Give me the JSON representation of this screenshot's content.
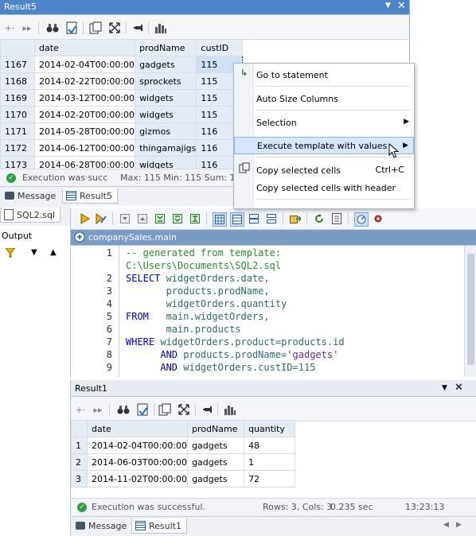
{
  "result5": {
    "title": "Result5",
    "columns": [
      "date",
      "prodName",
      "custID"
    ],
    "rows": [
      {
        "n": "1167",
        "date": "2014-02-04T00:00:00",
        "prod": "gadgets",
        "cust": "115"
      },
      {
        "n": "1168",
        "date": "2014-02-22T00:00:00",
        "prod": "sprockets",
        "cust": "115"
      },
      {
        "n": "1169",
        "date": "2014-03-12T00:00:00",
        "prod": "widgets",
        "cust": "115"
      },
      {
        "n": "1170",
        "date": "2014-02-20T00:00:00",
        "prod": "widgets",
        "cust": "115"
      },
      {
        "n": "1171",
        "date": "2014-05-28T00:00:00",
        "prod": "gizmos",
        "cust": "116"
      },
      {
        "n": "1172",
        "date": "2014-06-12T00:00:00",
        "prod": "thingamajigs",
        "cust": "116"
      },
      {
        "n": "1173",
        "date": "2014-06-28T00:00:00",
        "prod": "widgets",
        "cust": "116"
      }
    ],
    "status": "Execution was succ",
    "stats": "Max: 115  Min: 115   Sum: 11",
    "tabs": [
      "Message",
      "Result5"
    ]
  },
  "context_menu": {
    "items": [
      {
        "label": "Go to statement",
        "shortcut": ""
      },
      {
        "label": "Auto Size Columns",
        "shortcut": ""
      },
      {
        "label": "Selection",
        "shortcut": ""
      },
      {
        "label": "Execute template with values",
        "shortcut": ""
      },
      {
        "label": "Copy selected cells",
        "shortcut": "Ctrl+C"
      },
      {
        "label": "Copy selected cells with header",
        "shortcut": ""
      }
    ]
  },
  "left_panel": {
    "tab": "SQL2.sql",
    "output_label": "Output"
  },
  "editor": {
    "title": "companySales.main",
    "lines": [
      {
        "n": "1",
        "parts": [
          {
            "t": "-- generated from template:",
            "c": "cm"
          }
        ]
      },
      {
        "n": "",
        "parts": [
          {
            "t": "C:\\Users\\Documents\\SQL2.sql",
            "c": "cm"
          }
        ]
      },
      {
        "n": "2",
        "parts": [
          {
            "t": "SELECT ",
            "c": "kw"
          },
          {
            "t": "widgetOrders.date,",
            "c": "tx"
          }
        ]
      },
      {
        "n": "3",
        "parts": [
          {
            "t": "       products.prodName,",
            "c": "tx"
          }
        ]
      },
      {
        "n": "4",
        "parts": [
          {
            "t": "       widgetOrders.quantity",
            "c": "tx"
          }
        ]
      },
      {
        "n": "5",
        "parts": [
          {
            "t": "FROM   ",
            "c": "kw"
          },
          {
            "t": "main.widgetOrders,",
            "c": "tx"
          }
        ]
      },
      {
        "n": "6",
        "parts": [
          {
            "t": "       main.products",
            "c": "tx"
          }
        ]
      },
      {
        "n": "7",
        "parts": [
          {
            "t": "WHERE ",
            "c": "kw"
          },
          {
            "t": "widgetOrders.product=products.id",
            "c": "tx"
          }
        ]
      },
      {
        "n": "8",
        "parts": [
          {
            "t": "      AND ",
            "c": "kw"
          },
          {
            "t": "products.prodName=",
            "c": "tx"
          },
          {
            "t": "'gadgets'",
            "c": "st"
          }
        ]
      },
      {
        "n": "9",
        "parts": [
          {
            "t": "      AND ",
            "c": "kw"
          },
          {
            "t": "widgetOrders.custID=115",
            "c": "tx"
          }
        ]
      }
    ]
  },
  "result1": {
    "title": "Result1",
    "columns": [
      "date",
      "prodName",
      "quantity"
    ],
    "rows": [
      {
        "n": "1",
        "date": "2014-02-04T00:00:00",
        "prod": "gadgets",
        "qty": "48"
      },
      {
        "n": "2",
        "date": "2014-06-03T00:00:00",
        "prod": "gadgets",
        "qty": "1"
      },
      {
        "n": "3",
        "date": "2014-11-02T00:00:00",
        "prod": "gadgets",
        "qty": "72"
      }
    ],
    "status": "Execution was successful.",
    "rows_cols": "Rows: 3, Cols: 3",
    "time": "0.235 sec",
    "clock": "13:23:13",
    "tabs": [
      "Message",
      "Result1"
    ]
  }
}
